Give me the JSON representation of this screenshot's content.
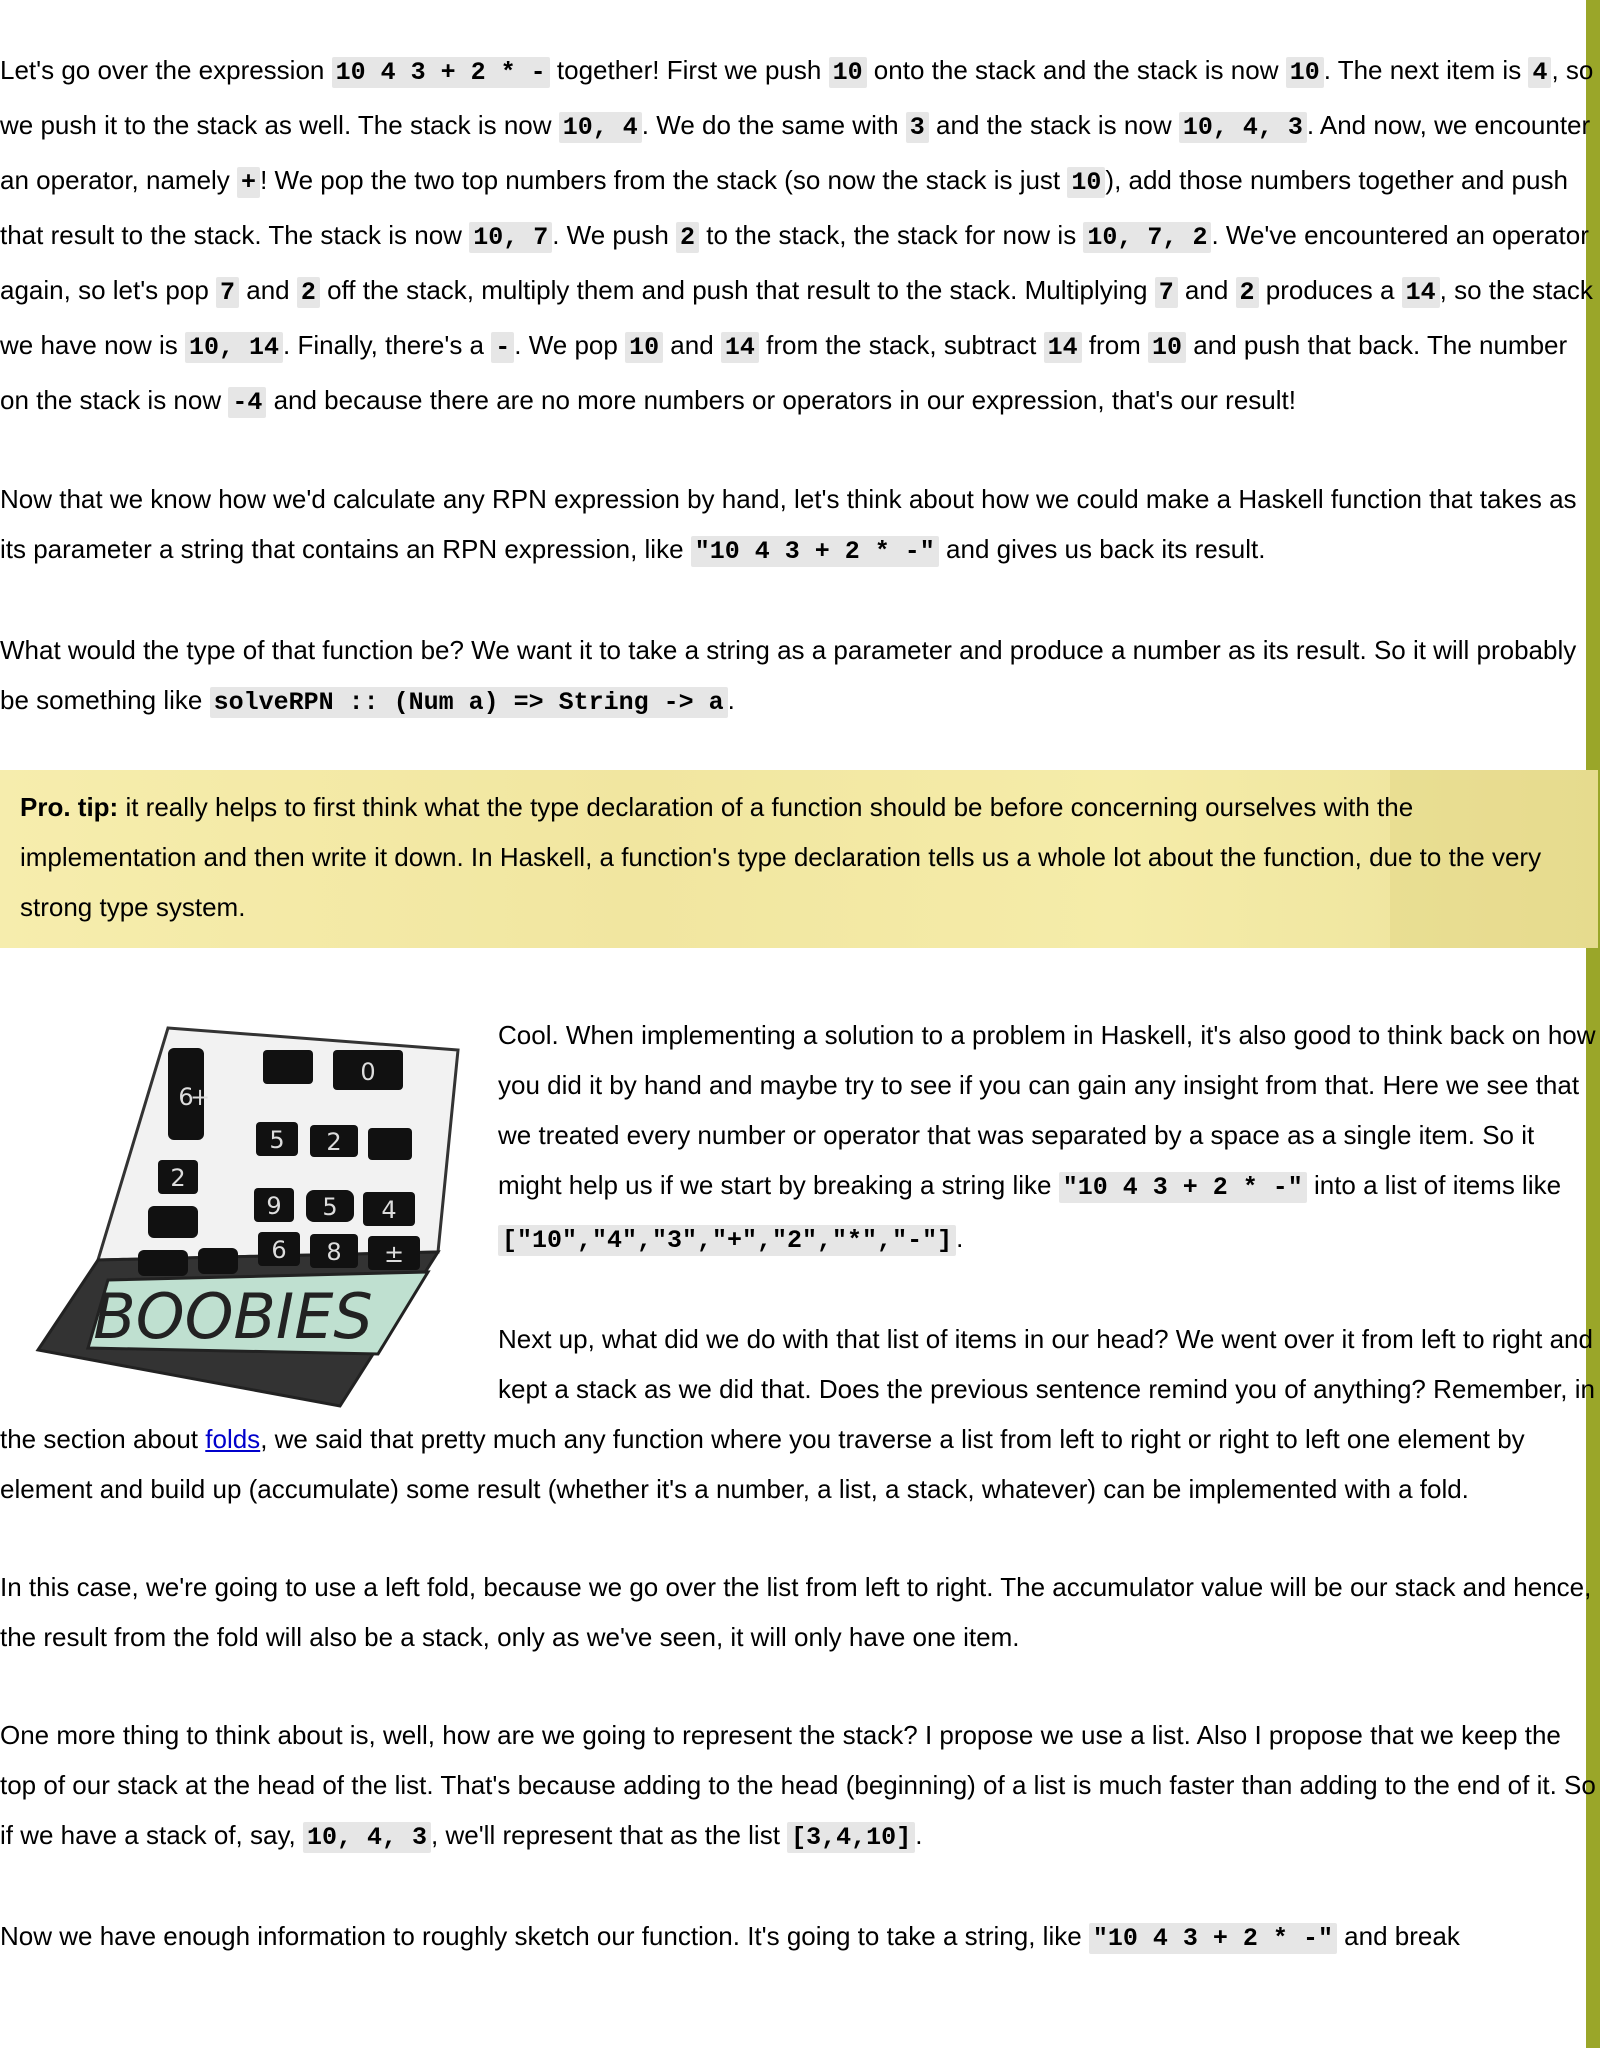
{
  "p1": {
    "t1": "Let's go over the expression ",
    "c1": "10 4 3 + 2 * -",
    "t2": " together! First we push ",
    "c2": "10",
    "t3": " onto the stack and the stack is now ",
    "c3": "10",
    "t4": ". The next item is ",
    "c4": "4",
    "t5": ", so we push it to the stack as well. The stack is now ",
    "c5": "10, 4",
    "t6": ". We do the same with ",
    "c6": "3",
    "t7": " and the stack is now ",
    "c7": "10, 4, 3",
    "t8": ". And now, we encounter an operator, namely ",
    "c8": "+",
    "t9": "! We pop the two top numbers from the stack (so now the stack is just ",
    "c9": "10",
    "t10": "), add those numbers together and push that result to the stack. The stack is now ",
    "c10": "10, 7",
    "t11": ". We push ",
    "c11": "2",
    "t12": " to the stack, the stack for now is ",
    "c12": "10, 7, 2",
    "t13": ". We've encountered an operator again, so let's pop ",
    "c13": "7",
    "t14": " and ",
    "c14": "2",
    "t15": " off the stack, multiply them and push that result to the stack. Multiplying ",
    "c15": "7",
    "t16": " and ",
    "c16": "2",
    "t17": " produces a ",
    "c17": "14",
    "t18": ", so the stack we have now is ",
    "c18": "10, 14",
    "t19": ". Finally, there's a ",
    "c19": "-",
    "t20": ". We pop ",
    "c20": "10",
    "t21": " and ",
    "c21": "14",
    "t22": " from the stack, subtract ",
    "c22": "14",
    "t23": " from ",
    "c23": "10",
    "t24": " and push that back. The number on the stack is now ",
    "c24": "-4",
    "t25": " and because there are no more numbers or operators in our expression, that's our result!"
  },
  "p2": {
    "t1": "Now that we know how we'd calculate any RPN expression by hand, let's think about how we could make a Haskell function that takes as its parameter a string that contains an RPN expression, like ",
    "c1": "\"10 4 3 + 2 * -\"",
    "t2": " and gives us back its result."
  },
  "p3": {
    "t1": "What would the type of that function be? We want it to take a string as a parameter and produce a number as its result. So it will probably be something like ",
    "c1": "solveRPN :: (Num a) => String -> a",
    "t2": "."
  },
  "tip": {
    "label": "Pro. tip:",
    "text": " it really helps to first think what the type declaration of a function should be before concerning ourselves with the implementation and then write it down. In Haskell, a function's type declaration tells us a whole lot about the function, due to the very strong type system."
  },
  "calculator": {
    "display_text": "BOOBIES",
    "key_glyphs": [
      "6",
      "+",
      "0",
      "2",
      "5",
      "2",
      "9",
      "5",
      "4",
      "6",
      "8",
      "±"
    ]
  },
  "p4": {
    "t1": "Cool. When implementing a solution to a problem in Haskell, it's also good to think back on how you did it by hand and maybe try to see if you can gain any insight from that. Here we see that we treated every number or operator that was separated by a space as a single item. So it might help us if we start by breaking a string like ",
    "c1": "\"10 4 3 + 2 * -\"",
    "t2": " into a list of items like ",
    "c2": "[\"10\",\"4\",\"3\",\"+\",\"2\",\"*\",\"-\"]",
    "t3": "."
  },
  "p5": {
    "t1": "Next up, what did we do with that list of items in our head? We went over it from left to right and kept a stack as we did that. Does the previous sentence remind you of anything? Remember, in the section about ",
    "link": "folds",
    "t2": ", we said that pretty much any function where you traverse a list from left to right or right to left one element by element and build up (accumulate) some result (whether it's a number, a list, a stack, whatever) can be implemented with a fold."
  },
  "p6": {
    "t1": "In this case, we're going to use a left fold, because we go over the list from left to right. The accumulator value will be our stack and hence, the result from the fold will also be a stack, only as we've seen, it will only have one item."
  },
  "p7": {
    "t1": "One more thing to think about is, well, how are we going to represent the stack? I propose we use a list. Also I propose that we keep the top of our stack at the head of the list. That's because adding to the head (beginning) of a list is much faster than adding to the end of it. So if we have a stack of, say, ",
    "c1": "10, 4, 3",
    "t2": ", we'll represent that as the list ",
    "c2": "[3,4,10]",
    "t3": "."
  },
  "p8": {
    "t1": "Now we have enough information to roughly sketch our function. It's going to take a string, like ",
    "c1": "\"10 4 3 + 2 * -\"",
    "t2": " and break"
  }
}
